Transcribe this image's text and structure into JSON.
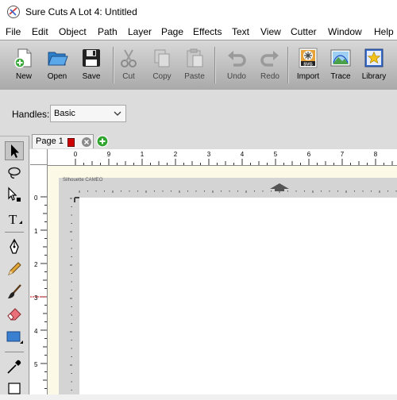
{
  "window": {
    "title": "Sure Cuts A Lot 4: Untitled"
  },
  "menu": [
    "File",
    "Edit",
    "Object",
    "Path",
    "Layer",
    "Page",
    "Effects",
    "Text",
    "View",
    "Cutter",
    "Window",
    "Help"
  ],
  "toolbar": [
    {
      "label": "New",
      "icon": "new-document-icon",
      "enabled": true
    },
    {
      "label": "Open",
      "icon": "open-folder-icon",
      "enabled": true
    },
    {
      "label": "Save",
      "icon": "floppy-disk-icon",
      "enabled": true
    },
    {
      "label": "Cut",
      "icon": "scissors-icon",
      "enabled": false
    },
    {
      "label": "Copy",
      "icon": "copy-icon",
      "enabled": false
    },
    {
      "label": "Paste",
      "icon": "paste-icon",
      "enabled": false
    },
    {
      "label": "Undo",
      "icon": "undo-icon",
      "enabled": false
    },
    {
      "label": "Redo",
      "icon": "redo-icon",
      "enabled": false
    },
    {
      "label": "Import",
      "icon": "import-svg-icon",
      "enabled": true
    },
    {
      "label": "Trace",
      "icon": "trace-image-icon",
      "enabled": true
    },
    {
      "label": "Library",
      "icon": "library-star-icon",
      "enabled": true
    }
  ],
  "options": {
    "handles_label": "Handles:",
    "handles_value": "Basic"
  },
  "tabs": {
    "page_label": "Page 1",
    "page_color": "#d10000"
  },
  "ruler": {
    "top_marks": [
      "0",
      "1",
      "2",
      "3",
      "4",
      "5",
      "6",
      "7",
      "8",
      "9"
    ],
    "left_marks": [
      "0",
      "1",
      "2",
      "3",
      "4",
      "5"
    ]
  },
  "mat": {
    "label": "Silhouette CAMEO"
  },
  "colors": {
    "toolbar": "#b5b5b5",
    "canvas": "#fdf9e7",
    "mat": "#d4d4d4",
    "accent_red": "#d10000"
  }
}
